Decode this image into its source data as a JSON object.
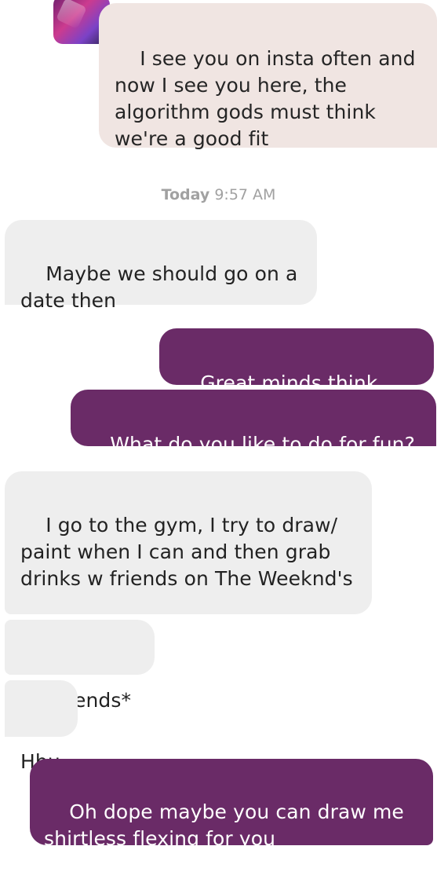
{
  "timestamp": {
    "day": "Today",
    "time": "9:57 AM"
  },
  "messages": [
    {
      "side": "sent-tinted",
      "text": "I see you on insta often and now I see you here, the algorithm gods must think we're a good fit"
    },
    {
      "side": "received",
      "text": "Maybe we should go on a date then"
    },
    {
      "side": "sent",
      "text": "Great minds think alike"
    },
    {
      "side": "sent",
      "text": "What do you like to do for fun?"
    },
    {
      "side": "received",
      "text": "I go to the gym, I try to draw/ paint when I can and then grab drinks w friends on The Weeknd's"
    },
    {
      "side": "received",
      "text": "Weekends*"
    },
    {
      "side": "received",
      "text": "Hbu"
    },
    {
      "side": "sent",
      "text": "Oh dope maybe you can draw me shirtless flexing for you"
    }
  ],
  "colors": {
    "sent": "#6a2b67",
    "received": "#eeeeee",
    "tinted": "#f0e5e2",
    "timestamp": "#a1a1a1"
  }
}
